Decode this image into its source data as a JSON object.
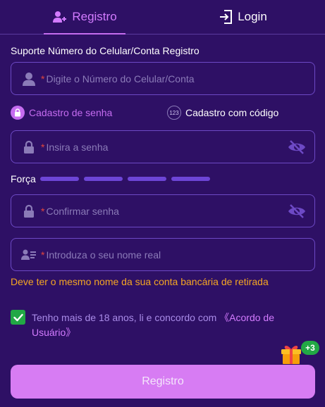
{
  "tabs": [
    {
      "label": "Registro",
      "icon": "user-plus-icon",
      "active": true
    },
    {
      "label": "Login",
      "icon": "login-icon",
      "active": false
    }
  ],
  "form": {
    "section_label": "Suporte Número do Celular/Conta Registro",
    "account_field": {
      "required_mark": "*",
      "placeholder": "Digite o Número do Celular/Conta",
      "icon": "user-icon"
    },
    "modes": {
      "password": {
        "label": "Cadastro de senha",
        "icon": "lock-circle-icon",
        "active": true
      },
      "code": {
        "label": "Cadastro com código",
        "icon_text": "123",
        "active": false
      }
    },
    "password_field": {
      "required_mark": "*",
      "placeholder": "Insira a senha",
      "icon": "lock-icon",
      "toggle_icon": "eye-off-icon"
    },
    "strength": {
      "label": "Força",
      "segments": 4,
      "filled_segments": 4
    },
    "confirm_field": {
      "required_mark": "*",
      "placeholder": "Confirmar senha",
      "icon": "lock-icon",
      "toggle_icon": "eye-off-icon"
    },
    "name_field": {
      "required_mark": "*",
      "placeholder": "Introduza o seu nome real",
      "icon": "id-card-icon"
    },
    "name_warning": "Deve ter o mesmo nome da sua conta bancária de retirada",
    "agreement": {
      "checked": true,
      "text": "Tenho mais de 18 anos, li e concordo com ",
      "link": "《Acordo de Usuário》"
    },
    "gift_badge": "+3",
    "submit_label": "Registro"
  },
  "colors": {
    "background": "#2e1065",
    "accent": "#c56cf0",
    "border": "#6d49c5",
    "warning": "#f5a623",
    "success": "#22a845",
    "submit_bg": "#d77cf3"
  }
}
